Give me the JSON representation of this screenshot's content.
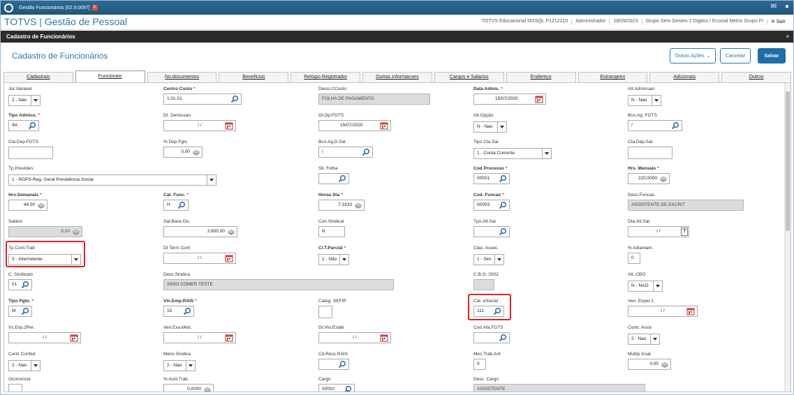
{
  "window": {
    "title": "Gestão Funcionários [02.9.0097]"
  },
  "app": {
    "title": "TOTVS | Gestão de Pessoal",
    "db": "TOTVS Educacional MSSQL P1212210",
    "user": "Administrador",
    "date": "18/09/2023",
    "company": "Grupo Sem Gesteo 2 Digitos / Ecosial Metriz Grupo FI",
    "exit": "Sair"
  },
  "modal": {
    "title": "Cadastro de Funcionários",
    "close": "×"
  },
  "header": {
    "title": "Cadastro de Funcionários",
    "more_actions": "Outras Ações",
    "cancel": "Cancelar",
    "save": "Salvar"
  },
  "tabs": [
    "Cadastrais",
    "Funcionais",
    "No.documentos",
    "Beneficios",
    "Relógio Registrador",
    "Outras Informacoes",
    "Cargos e Salarios",
    "Endereço",
    "Estrangeiro",
    "Adicionais",
    "Outros"
  ],
  "fields": {
    "jor_variavel": {
      "label": "Jor.Variavel",
      "value": "2 - Nao"
    },
    "centro_custo": {
      "label": "Centro Custo",
      "value": "1.01.01"
    },
    "descr_ccusto": {
      "label": "Descr.CCusto",
      "value": "FOLHA DE PAGAMENTO"
    },
    "data_admis": {
      "label": "Data Admis.",
      "value": "15/07/2020"
    },
    "alt_admissao": {
      "label": "Alt.Admissao",
      "value": "N - Nao"
    },
    "tipo_admiss": {
      "label": "Tipo Admiss.",
      "value": "9A"
    },
    "dt_demissao": {
      "label": "Dt. Demissao",
      "value": "/ /"
    },
    "dt_op_fgts": {
      "label": "Dt.Op.FGTS",
      "value": "15/07/2020"
    },
    "alt_opcao": {
      "label": "Alt.Opção",
      "value": "N - Nao"
    },
    "bco_ag_fgts": {
      "label": "Bco.Ag. FGTS",
      "value": "/"
    },
    "cta_dep_fgts": {
      "label": "Cta.Dep.FGTS",
      "value": ""
    },
    "pct_dep_fgts": {
      "label": "% Dep.Fgts",
      "value": "0,00"
    },
    "bco_ag_d_sal": {
      "label": "Bco.Ag.D.Sal",
      "value": "/"
    },
    "tipo_cta_sal": {
      "label": "Tipo Cta Sal",
      "value": "1 - Conta Corrente"
    },
    "cta_dep_sal": {
      "label": "Cta.Dep.Sal.",
      "value": ""
    },
    "tp_previden": {
      "label": "Tp Previden.",
      "value": "1 - RGPS-Reg. Geral Previdência Social"
    },
    "sit_folha": {
      "label": "Sit. Folha",
      "value": ""
    },
    "cod_processo": {
      "label": "Cod Processo",
      "value": "00001"
    },
    "hrs_mensais": {
      "label": "Hrs. Mensais",
      "value": "220,0000"
    },
    "hrs_semanais": {
      "label": "Hrs.Semanais",
      "value": "44,00"
    },
    "cat_func": {
      "label": "Cat. Func.",
      "value": "H"
    },
    "horas_dia": {
      "label": "Horas Dia",
      "value": "7,3333"
    },
    "cod_funcao": {
      "label": "Cod. Funcao",
      "value": "00003"
    },
    "desc_funcao": {
      "label": "Desc.Funcao",
      "value": "ASSISTENTE DE ESCRIT"
    },
    "salario": {
      "label": "Salário",
      "value": "0,00"
    },
    "sal_base_dis": {
      "label": "Sal.Base.Dis",
      "value": "2.600,00"
    },
    "con_sindical": {
      "label": "Con.Sindical",
      "value": "N"
    },
    "tpo_alt_sal": {
      "label": "Tpo.Alt.Sal",
      "value": ""
    },
    "dta_alt_sal": {
      "label": "Dta.Alt.Sal.",
      "value": "/ /"
    },
    "tp_cont_trab": {
      "label": "Tp.Cont.Trab",
      "value": "3 - Intermitente"
    },
    "dt_term_cont": {
      "label": "Dt Term Cont",
      "value": "/ /"
    },
    "clt_parcial": {
      "label": "Cl.T.Parcial",
      "value": "2 - Não"
    },
    "clau_assec": {
      "label": "Clau. Assec.",
      "value": "1 - Sim"
    },
    "pct_adiant": {
      "label": "% Adiantam.",
      "value": "0"
    },
    "c_sindicato": {
      "label": "C. Sindicato",
      "value": "01"
    },
    "desc_sindica": {
      "label": "Desc.Sindica",
      "value": "SINDI COMER TESTE"
    },
    "cbo_2002": {
      "label": "C.B.O. 2002",
      "value": ""
    },
    "alt_cbo": {
      "label": "Alt. CBO",
      "value": "N - NAO"
    },
    "tipo_pgto": {
      "label": "Tipo Pgto.",
      "value": "M"
    },
    "vin_emp_rais": {
      "label": "Vin.Emp.RAIS",
      "value": "15"
    },
    "categ_sefip": {
      "label": "Categ. SEFIP",
      "value": ""
    },
    "cat_esocial": {
      "label": "Cat. eSocial",
      "value": "111"
    },
    "ven_exper_1": {
      "label": "Ven. Exper.1",
      "value": "/ /"
    },
    "vc_exp_2per": {
      "label": "Vc.Exp.2Per.",
      "value": "/ /"
    },
    "ven_exa_med": {
      "label": "Ven.Exa.Med.",
      "value": "/ /"
    },
    "dt_vto_estab": {
      "label": "Dt.Vto.Estab",
      "value": "/ /"
    },
    "cod_afa_fgts": {
      "label": "Cod.Afa.FGTS",
      "value": ""
    },
    "contr_assis": {
      "label": "Contr. Assis",
      "value": "2 - Nao"
    },
    "contr_confed": {
      "label": "Contr Confed",
      "value": "2 - Nao"
    },
    "mens_sindica": {
      "label": "Mens Sindica",
      "value": "2 - Nao"
    },
    "cd_resc_rais": {
      "label": "Cd.Resc.RAIS",
      "value": ""
    },
    "mes_trab_ant": {
      "label": "Mes.Trab.Ant",
      "value": "0"
    },
    "multip_insal": {
      "label": "Multip Insal",
      "value": "0,00"
    },
    "ocorrencia": {
      "label": "Ocorrencia",
      "value": ""
    },
    "pct_acid_trab": {
      "label": "% Acid.Trab.",
      "value": "0,0000"
    },
    "cargo": {
      "label": "Cargo",
      "value": "00002"
    },
    "desc_cargo": {
      "label": "Desc. Cargo",
      "value": "ASSISTENTE"
    }
  }
}
